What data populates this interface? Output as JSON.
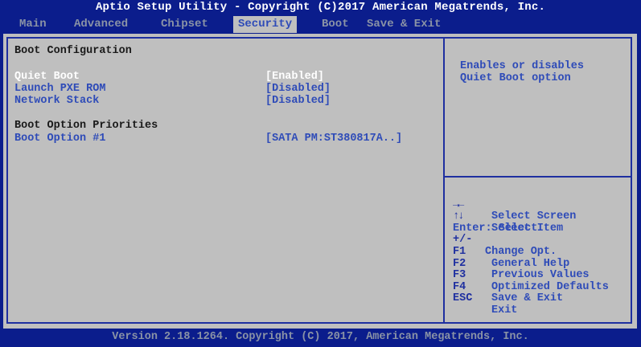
{
  "header": {
    "title": "Aptio Setup Utility - Copyright (C)2017 American Megatrends, Inc."
  },
  "tabs": [
    {
      "label": "Main"
    },
    {
      "label": "Advanced"
    },
    {
      "label": "Chipset"
    },
    {
      "label": "Security"
    },
    {
      "label": "Boot"
    },
    {
      "label": "Save & Exit"
    }
  ],
  "main": {
    "section_title": "Boot Configuration",
    "settings": [
      {
        "label": "Quiet Boot",
        "value": "[Enabled]"
      },
      {
        "label": "Launch PXE ROM",
        "value": "[Disabled]"
      },
      {
        "label": "Network Stack",
        "value": "[Disabled]"
      }
    ],
    "priorities_title": "Boot Option Priorities",
    "boot_options": [
      {
        "label": "Boot Option #1",
        "value": "[SATA PM:ST380817A..]"
      }
    ]
  },
  "help": {
    "line1": "Enables or disables",
    "line2": "Quiet Boot option"
  },
  "keys": [
    {
      "key": "→←",
      "desc": "Select Screen"
    },
    {
      "key": "↑↓",
      "desc": "Select Item"
    },
    {
      "key": "",
      "desc": "Enter: Select"
    },
    {
      "key": "+/-",
      "desc": "Change Opt."
    },
    {
      "key": "F1",
      "desc": "General Help"
    },
    {
      "key": "F2",
      "desc": "Previous Values"
    },
    {
      "key": "F3",
      "desc": "Optimized Defaults"
    },
    {
      "key": "F4",
      "desc": "Save & Exit"
    },
    {
      "key": "ESC",
      "desc": "Exit"
    }
  ],
  "footer": {
    "text": "Version 2.18.1264. Copyright (C) 2017, American Megatrends, Inc."
  },
  "colors": {
    "background": "#0B1D8C",
    "panel": "#BFBFBF",
    "item_text": "#2E4BB8",
    "selected_text": "#FFFFFF",
    "inactive_tab": "#8A93A6"
  }
}
